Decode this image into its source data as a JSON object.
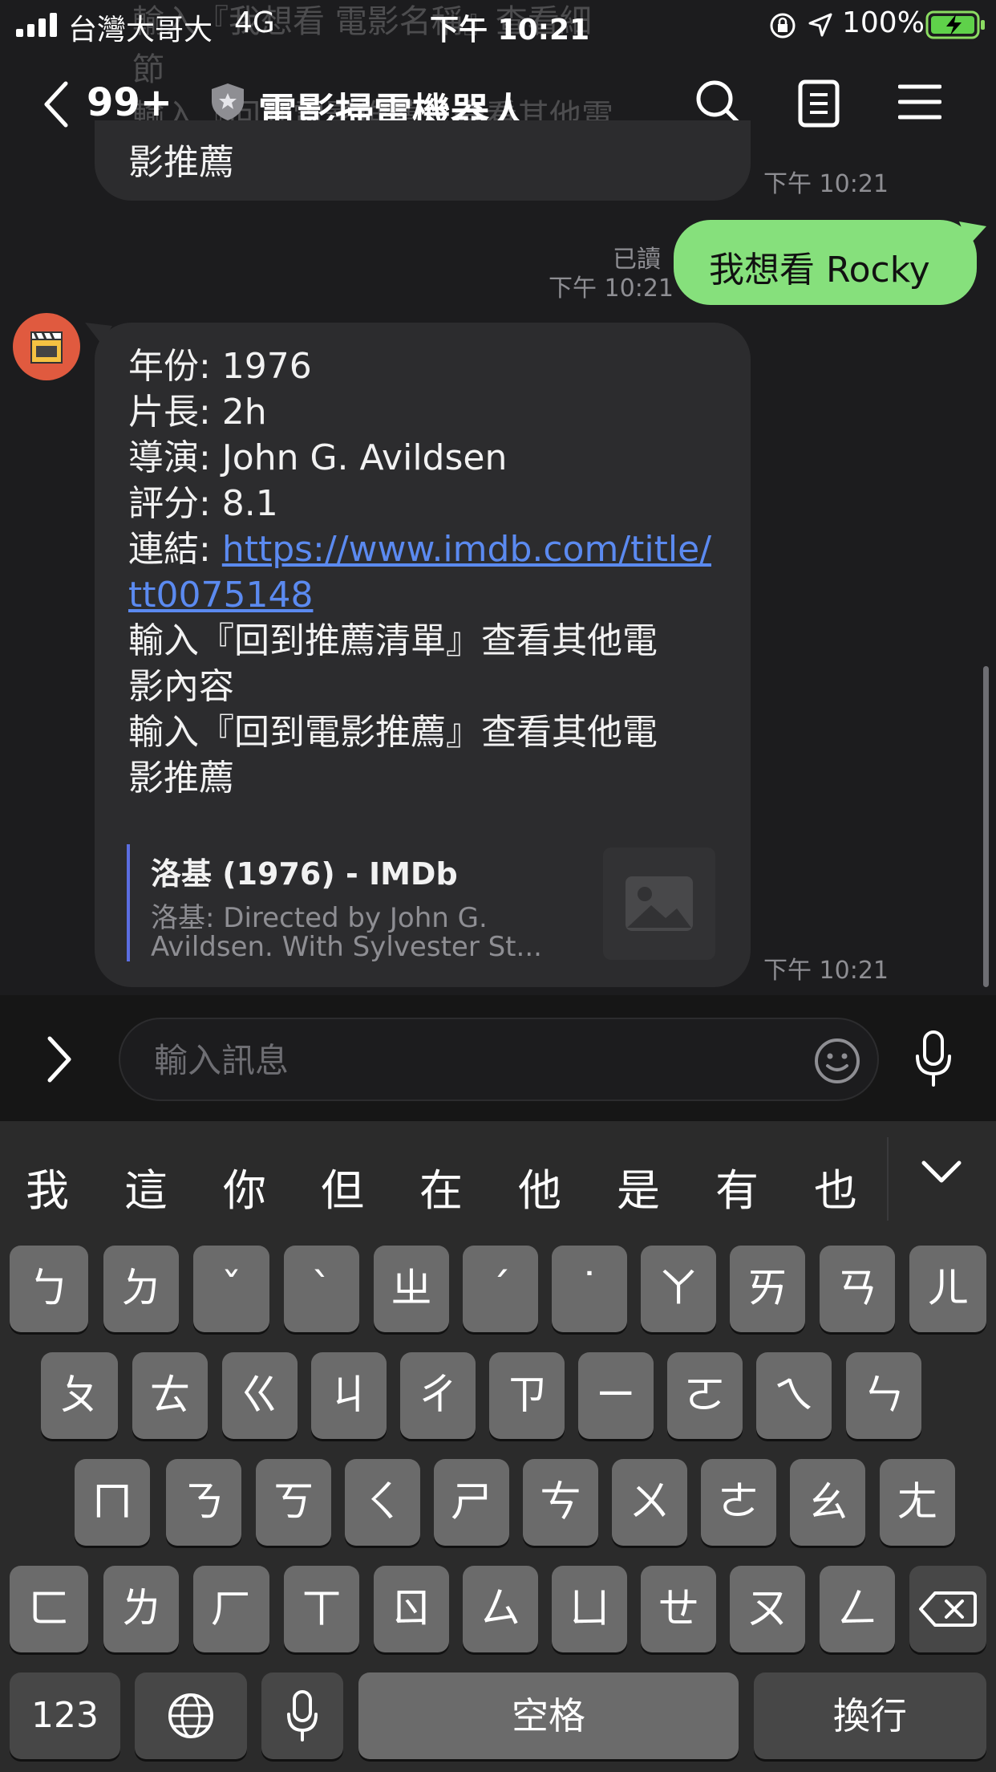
{
  "status_bar": {
    "carrier": "台灣大哥大",
    "network": "4G",
    "time": "下午 10:21",
    "battery": "100%"
  },
  "nav": {
    "back_count": "99+",
    "title": "電影掃雷機器人"
  },
  "faded_background": {
    "line1": "輸入『我想看 電影名稱』查看細",
    "line2": "節",
    "line3": "輸入『回到電影推薦』查看其他電"
  },
  "prev_message": {
    "tail_text": "影推薦",
    "time": "下午 10:21"
  },
  "outgoing_message": {
    "read": "已讀",
    "time": "下午 10:21",
    "text": "我想看 Rocky"
  },
  "bot_message": {
    "year": "年份: 1976",
    "length": "片長: 2h",
    "director": "導演: John G. Avildsen",
    "rating": "評分: 8.1",
    "link_label": "連結: ",
    "link_part1": "https://www.imdb.com/title/",
    "link_part2": "tt0075148",
    "line_recommend_list_1": "輸入『回到推薦清單』查看其他電",
    "line_recommend_list_2": "影內容",
    "line_recommend_movie_1": "輸入『回到電影推薦』查看其他電",
    "line_recommend_movie_2": "影推薦",
    "preview_title": "洛基 (1976) - IMDb",
    "preview_desc_1": "洛基: Directed by John G.",
    "preview_desc_2": "Avildsen. With Sylvester St...",
    "time": "下午 10:21"
  },
  "input": {
    "placeholder": "輸入訊息"
  },
  "keyboard": {
    "candidates": [
      "我",
      "這",
      "你",
      "但",
      "在",
      "他",
      "是",
      "有",
      "也"
    ],
    "row1": [
      "ㄅ",
      "ㄉ",
      "ˇ",
      "ˋ",
      "ㄓ",
      "ˊ",
      "˙",
      "ㄚ",
      "ㄞ",
      "ㄢ",
      "ㄦ"
    ],
    "row2": [
      "ㄆ",
      "ㄊ",
      "ㄍ",
      "ㄐ",
      "ㄔ",
      "ㄗ",
      "ㄧ",
      "ㄛ",
      "ㄟ",
      "ㄣ"
    ],
    "row3": [
      "ㄇ",
      "ㄋ",
      "ㄎ",
      "ㄑ",
      "ㄕ",
      "ㄘ",
      "ㄨ",
      "ㄜ",
      "ㄠ",
      "ㄤ"
    ],
    "row4": [
      "ㄈ",
      "ㄌ",
      "ㄏ",
      "ㄒ",
      "ㄖ",
      "ㄙ",
      "ㄩ",
      "ㄝ",
      "ㄡ",
      "ㄥ"
    ],
    "key_123": "123",
    "key_space": "空格",
    "key_return": "換行"
  },
  "colors": {
    "outgoing_bubble": "#86e07c",
    "link": "#5b8af0",
    "background": "#1c1c1e"
  }
}
